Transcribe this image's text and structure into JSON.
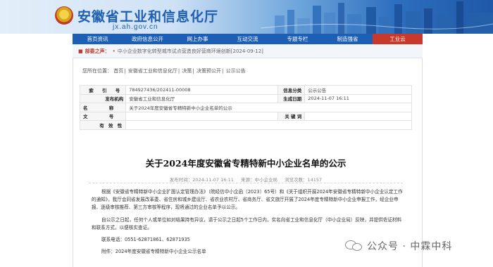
{
  "header": {
    "site_title": "安徽省工业和信息化厅",
    "site_url": "jx.ah.gov.cn"
  },
  "nav": {
    "items": [
      "首页资讯",
      "政府信息公开",
      "网上办事",
      "互动交流",
      "专题专栏",
      "制造强省",
      "工业云"
    ],
    "active_index": 6
  },
  "topcrumb": {
    "lead": "部委之声：",
    "text": "中小企业数字化转型城市试点营造良好营商环境创新[2024-09-12]"
  },
  "location": {
    "prefix": "您所在位置：",
    "items": [
      "首页",
      "安徽省工业和信息化厅",
      "决策",
      "决策预公开",
      "公示公告"
    ]
  },
  "meta": {
    "index_label": "索 引 号",
    "index_value": "784927436/202411-00008",
    "category_label": "信息分类",
    "category_value": "公示公告",
    "org_label": "发布机构",
    "org_value": "安徽省工业和信息化厅",
    "date_label": "生成日期",
    "date_value": "2024-11-07 16:11",
    "name_label": "名 称",
    "name_value": "关于2024年度安徽省专精特新中小企业名单的公示",
    "doc_label": "文 号",
    "doc_value": "",
    "kw_label": "关 键 词",
    "kw_value": "",
    "valid_label": "有 效 性",
    "valid_value": ""
  },
  "article": {
    "title": "关于2024年度安徽省专精特新中小企业名单的公示",
    "pub_date": "发布时间：2024-11-07 16:11",
    "source": "来源：中小企业局",
    "views": "浏览次数：14157",
    "para1": "根据《安徽省专精特新中小企业扩面认定管理办法》（皖经信中小企函〔2023〕65号）和《关于组织开展2024年安徽省专精特新中小企业认定工作的通知》，我厅会同省发展改革委、省住房和城乡建设厅、省农业农村厅、省商务厅、省文旅厅开展了2024年度专精特新中小企业申报工作，经企业申报、逐级审核推荐、第三方审核等程序，现将通过的企业名单予以公示。",
    "para2": "自公示之日起，任何个人或单位如对结果持有异议，请于公示之日起5个工作日内，实名向省工业和信息化厅（中小企业局）反映，并提供佐证材料和联系方式，以便核实查证。",
    "contact": "联系电话：0551-62871861、62871935",
    "attachment": "附件：2024年度安徽省专精特新中小企业公示名单"
  },
  "watermark": {
    "text": "公众号 · 中霖中科"
  },
  "colors": {
    "nav_blue": "#1d5fb4",
    "nav_active": "#c8392b",
    "title_blue": "#1f5fb0"
  }
}
